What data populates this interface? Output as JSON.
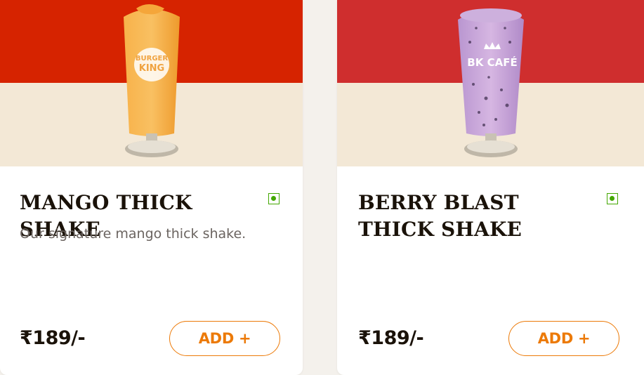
{
  "products": [
    {
      "title": "MANGO THICK SHAKE",
      "description": "Our signature mango thick shake.",
      "price": "₹189/-",
      "add_label": "ADD +",
      "glass_logo": "BURGER KING",
      "veg": true,
      "bg_top_color": "#d62300",
      "drink_color": "#f5a63a"
    },
    {
      "title": "BERRY BLAST THICK SHAKE",
      "description": "",
      "price": "₹189/-",
      "add_label": "ADD +",
      "glass_logo": "BK CAFÉ",
      "veg": true,
      "bg_top_color": "#cf2e2e",
      "drink_color": "#c9a4d8"
    }
  ],
  "colors": {
    "accent": "#ec7a08",
    "veg_green": "#43a700",
    "hero_bottom": "#f3e8d6"
  }
}
